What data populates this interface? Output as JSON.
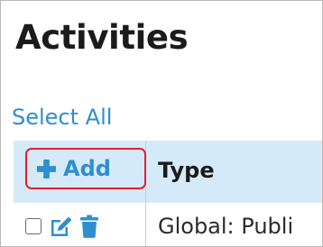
{
  "section": {
    "title": "Activities"
  },
  "controls": {
    "select_all_label": "Select All"
  },
  "table": {
    "add_label": "Add",
    "header": {
      "type_label": "Type"
    },
    "rows": [
      {
        "type": "Global: Publi"
      }
    ]
  },
  "colors": {
    "accent": "#2e8fcf",
    "header_bg": "#d5eaf8",
    "highlight": "#e02030",
    "text": "#1b1b1b"
  },
  "icons": [
    "plus-icon",
    "edit-icon",
    "trash-icon"
  ]
}
